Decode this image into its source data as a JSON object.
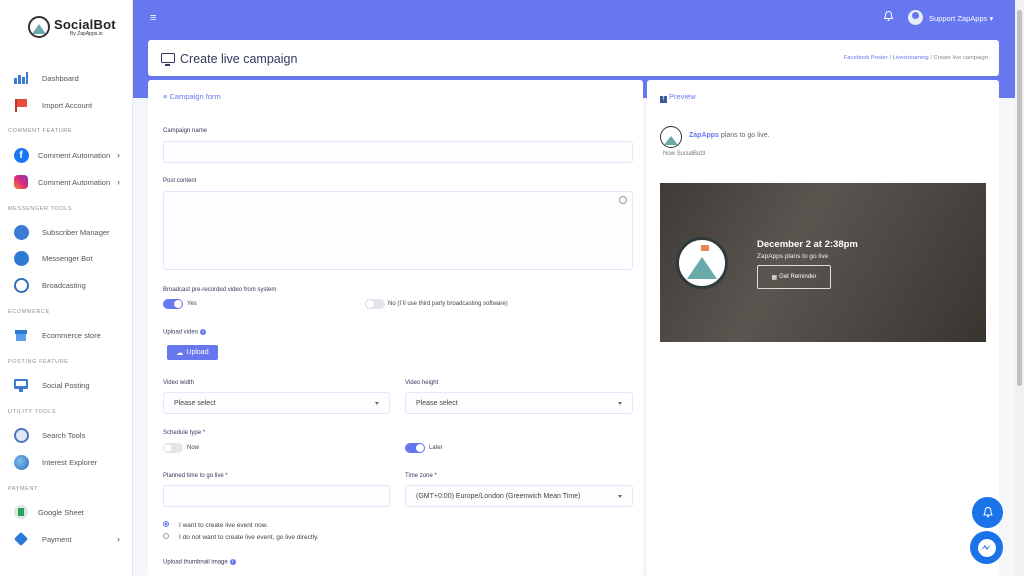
{
  "brand": {
    "name": "SocialBot",
    "sub": "By ZapApps.io"
  },
  "sidebar": {
    "items": [
      {
        "label": "Dashboard"
      },
      {
        "label": "Import Account"
      },
      {
        "label": "Comment Automation"
      },
      {
        "label": "Comment Automation"
      },
      {
        "label": "Subscriber Manager"
      },
      {
        "label": "Messenger Bot"
      },
      {
        "label": "Broadcasting"
      },
      {
        "label": "Ecommerce store"
      },
      {
        "label": "Social Posting"
      },
      {
        "label": "Search Tools"
      },
      {
        "label": "Interest Explorer"
      },
      {
        "label": "Google Sheet"
      },
      {
        "label": "Payment"
      }
    ],
    "headings": {
      "comment": "COMMENT FEATURE",
      "messenger": "MESSENGER TOOLS",
      "ecommerce": "ECOMMERCE",
      "posting": "POSTING FEATURE",
      "utility": "UTILITY TOOLS",
      "payment": "PAYMENT"
    }
  },
  "topbar": {
    "user": "Support ZapApps"
  },
  "header": {
    "title": "Create live campaign",
    "crumb1": "Facebook Poster",
    "crumb2": "Livestreaming",
    "crumb3": "Create live campaign",
    "sep": "/"
  },
  "form": {
    "heading": "Campaign form",
    "campaign_name_label": "Campaign name",
    "post_content_label": "Post content",
    "broadcast_label": "Broadcast pre-recorded video from system",
    "broadcast_yes": "Yes",
    "broadcast_no": "No (I`ll use third party broadcasting software)",
    "upload_video_label": "Upload video",
    "upload_button": "Upload",
    "video_width_label": "Video width",
    "video_width_value": "Please select",
    "video_height_label": "Video height",
    "video_height_value": "Please select",
    "schedule_label": "Schedule type *",
    "schedule_now": "Now",
    "schedule_later": "Later",
    "planned_label": "Planned time to go live *",
    "timezone_label": "Time zone *",
    "timezone_value": "(GMT+0:00) Europe/London (Greenwich Mean Time)",
    "radio1": "I want to create live event now.",
    "radio2": "I do not want to create live event, go live directly.",
    "thumb_label": "Upload thumbnail image"
  },
  "preview": {
    "heading": "Preview",
    "page_name": "ZapApps",
    "plans": "plans to go live.",
    "sub": "Now SocialBot3",
    "date": "December 2 at 2:38pm",
    "plan_line": "ZapApps plans to go live",
    "reminder": "Get Reminder"
  },
  "colors": {
    "accent": "#6777ef",
    "facebook": "#3b5998",
    "messenger": "#1a73e8"
  }
}
